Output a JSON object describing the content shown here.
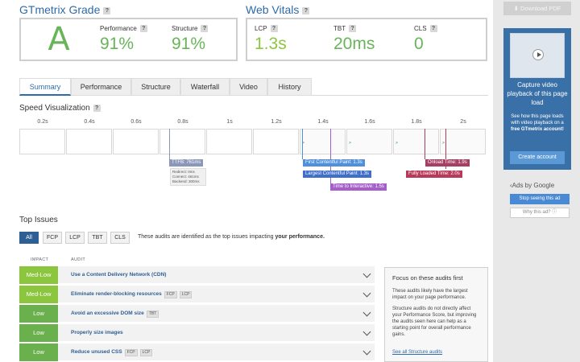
{
  "grade": {
    "title": "GTmetrix Grade",
    "letter": "A",
    "performance_label": "Performance",
    "performance_value": "91%",
    "structure_label": "Structure",
    "structure_value": "91%"
  },
  "vitals": {
    "title": "Web Vitals",
    "lcp_label": "LCP",
    "lcp_value": "1.3s",
    "tbt_label": "TBT",
    "tbt_value": "20ms",
    "cls_label": "CLS",
    "cls_value": "0"
  },
  "tabs": [
    "Summary",
    "Performance",
    "Structure",
    "Waterfall",
    "Video",
    "History"
  ],
  "speed": {
    "title": "Speed Visualization",
    "ticks": [
      "0.2s",
      "0.4s",
      "0.6s",
      "0.8s",
      "1s",
      "1.2s",
      "1.4s",
      "1.6s",
      "1.8s",
      "2s"
    ],
    "markers": {
      "ttfb": "TTFB: 761ms",
      "ttfb_redirect": "Redirect: 0ms",
      "ttfb_connect": "Connect: 461ms",
      "ttfb_backend": "Backend: 300ms",
      "fcp": "First Contentful Paint: 1.3s",
      "lcp": "Largest Contentful Paint: 1.3s",
      "tti": "Time to Interactive: 1.5s",
      "onload": "Onload Time: 1.9s",
      "fully": "Fully Loaded Time: 2.0s"
    },
    "colors": {
      "ttfb": "#8a97b8",
      "fcp": "#4f8fdc",
      "lcp": "#3f6fc8",
      "tti": "#a45fc9",
      "onload": "#a53f63",
      "fully": "#b83a5a"
    }
  },
  "issues": {
    "title": "Top Issues",
    "filters": [
      "All",
      "FCP",
      "LCP",
      "TBT",
      "CLS"
    ],
    "filter_note": "These audits are identified as the top issues impacting",
    "filter_note_bold": "your performance.",
    "col_impact": "IMPACT",
    "col_audit": "AUDIT",
    "rows": [
      {
        "impact": "Med-Low",
        "audit": "Use a Content Delivery Network (CDN)",
        "tags": []
      },
      {
        "impact": "Med-Low",
        "audit": "Eliminate render-blocking resources",
        "tags": [
          "FCP",
          "LCP"
        ]
      },
      {
        "impact": "Low",
        "audit": "Avoid an excessive DOM size",
        "tags": [
          "TBT"
        ]
      },
      {
        "impact": "Low",
        "audit": "Properly size images",
        "tags": []
      },
      {
        "impact": "Low",
        "audit": "Reduce unused CSS",
        "tags": [
          "FCP",
          "LCP"
        ]
      }
    ],
    "focus": {
      "title": "Focus on these audits first",
      "p1": "These audits likely have the largest impact on your page performance.",
      "p2": "Structure audits do not directly affect your Performance Score, but improving the audits seen here can help as a starting point for overall performance gains.",
      "link": "See all Structure audits"
    }
  },
  "sidebar": {
    "download": "Download PDF",
    "ad_heading": "Capture video playback of this page load",
    "ad_text_1": "See how this page loads with video playback on a",
    "ad_text_bold": "free GTmetrix account!",
    "ad_button": "Create account",
    "ads_by": "Ads by Google",
    "stop": "Stop seeing this ad",
    "why": "Why this ad? ⓘ"
  }
}
